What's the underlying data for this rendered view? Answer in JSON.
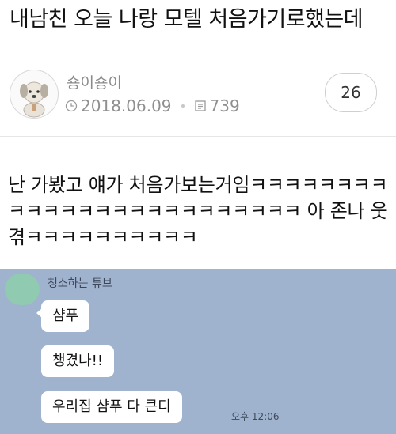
{
  "post": {
    "title": "내남친 오늘 나랑 모텔 처음가기로했는데",
    "author": "숑이숑이",
    "date": "2018.06.09",
    "views": "739",
    "comment_count": "26",
    "body": "난 가봤고 얘가 처음가보는거임ㅋㅋㅋㅋㅋㅋㅋㅋㅋㅋㅋㅋㅋㅋㅋㅋㅋㅋㅋㅋㅋㅋㅋㅋㅋ 아 존나 웃겪ㅋㅋㅋㅋㅋㅋㅋㅋㅋㅋ"
  },
  "chat": {
    "sender": "청소하는 튜브",
    "messages": [
      "샴푸",
      "챙겼나!!",
      "우리집 샴푸 다 큰디"
    ],
    "time": "오후 12:06"
  },
  "colors": {
    "chat_background": "#9fb3cf",
    "avatar_green": "#8fcab1"
  }
}
